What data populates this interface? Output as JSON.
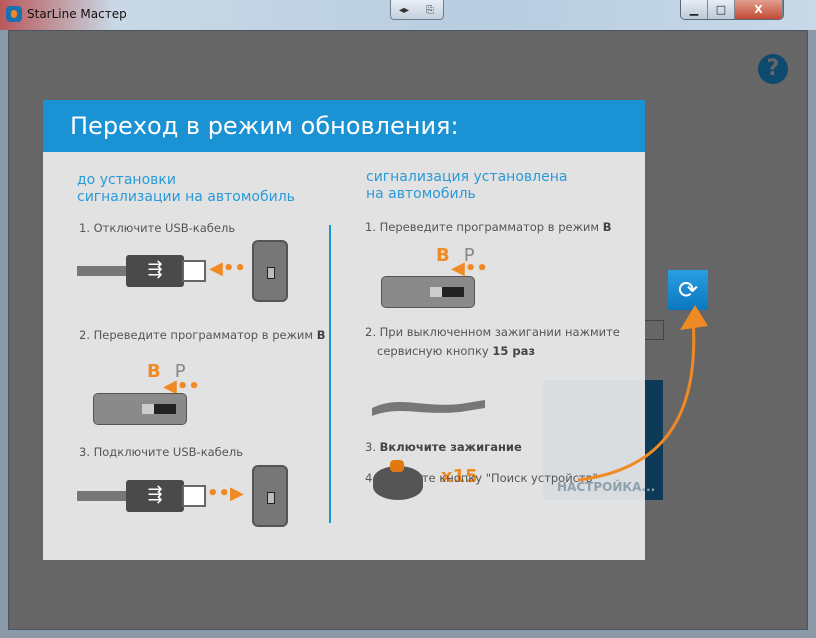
{
  "window": {
    "title": "StarLine Мастер",
    "controls": {
      "minimize": "▁",
      "maximize": "□",
      "close": "X"
    }
  },
  "background": {
    "settings_tile": "НАСТРОЙКА...",
    "help": "?",
    "refresh": "⟳"
  },
  "dialog": {
    "title": "Переход в режим обновления:",
    "left": {
      "heading1": "до установки",
      "heading2": "сигнализации на автомобиль",
      "step1": "1. Отключите USB-кабель",
      "step2": "2. Переведите программатор в режим ",
      "step2_bold": "B",
      "step3": "3. Подключите USB-кабель"
    },
    "right": {
      "heading1": "сигнализация установлена",
      "heading2": "на автомобиль",
      "step1": "1. Переведите программатор в режим ",
      "step1_bold": "B",
      "step2a": "2. При выключенном зажигании нажмите",
      "step2b": "сервисную кнопку ",
      "step2_bold": "15 раз",
      "step3": "3. ",
      "step3_bold": "Включите зажигание",
      "step4": "4. Нажмите кнопку \"Поиск устройств\""
    },
    "mode_b": "B",
    "mode_p": "P",
    "times": "x15",
    "usb_symbol": "⭠"
  },
  "colors": {
    "accent": "#1a92d4",
    "orange": "#f08a24"
  }
}
